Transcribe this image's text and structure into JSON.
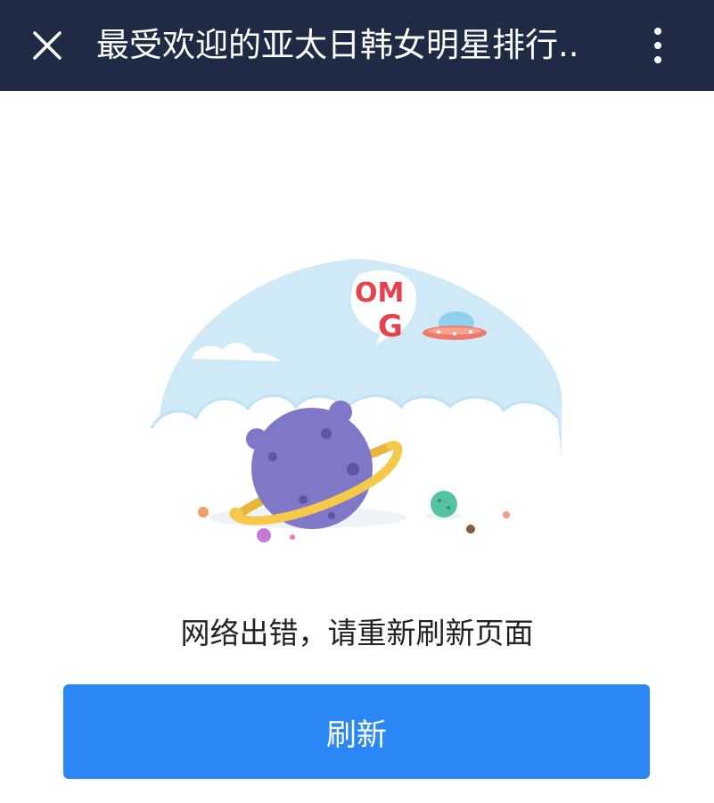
{
  "header": {
    "title": "最受欢迎的亚太日韩女明星排行..",
    "close_icon": "close-icon",
    "more_icon": "more-vertical-icon"
  },
  "illustration": {
    "badge_text_1": "OM",
    "badge_text_2": "G"
  },
  "error": {
    "message": "网络出错，请重新刷新页面"
  },
  "actions": {
    "refresh_label": "刷新"
  },
  "colors": {
    "header_bg": "#1f2a44",
    "button_bg": "#2b87f5",
    "sky": "#cfe9f7",
    "planet": "#7f78c8",
    "ring": "#f6c94a"
  }
}
